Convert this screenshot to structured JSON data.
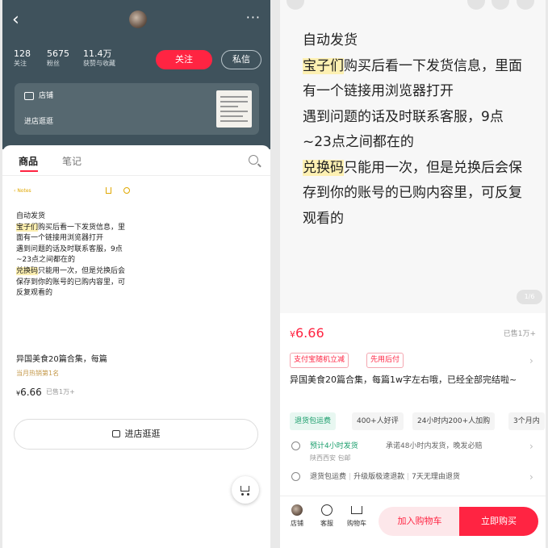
{
  "colors": {
    "brand": "#ff2442",
    "header_bg": "#3f525c",
    "highlight": "#fdf0b2",
    "green": "#1a9e6c"
  },
  "shop": {
    "stats": [
      {
        "num": "128",
        "label": "关注"
      },
      {
        "num": "5675",
        "label": "粉丝"
      },
      {
        "num": "11.4万",
        "label": "获赞与收藏"
      }
    ],
    "follow": "关注",
    "message": "私信",
    "store_label": "店铺",
    "store_link": "进店逛逛"
  },
  "tabs": {
    "goods": "商品",
    "notes": "笔记"
  },
  "note": {
    "app_back": "Notes",
    "lines": [
      {
        "hl": "",
        "text": "自动发货"
      },
      {
        "hl": "宝子们",
        "text": "购买后看一下发货信息，里面有一个链接用浏览器打开"
      },
      {
        "hl": "",
        "text": "遇到问题的话及时联系客服，9点~23点之间都在的"
      },
      {
        "hl": "兑换码",
        "text": "只能用一次，但是兑换后会保存到你的账号的已购内容里，可反复观看的"
      }
    ]
  },
  "product": {
    "title_short": "异国美食20篇合集，每篇",
    "rank": "当月热销第1名",
    "currency": "¥",
    "price": "6.66",
    "sold": "已售1万+"
  },
  "visit_store": "进店逛逛",
  "detail": {
    "page": "1/6",
    "tags": [
      "支付宝随机立减",
      "先用后付"
    ],
    "title": "异国美食20篇合集，每篇1w字左右哦，已经全部完结啦~",
    "features": [
      "退货包运费",
      "400+人好评",
      "24小时内200+人加购",
      "3个月内"
    ],
    "ship_fast": "预计4小时发货",
    "ship_promise": "承诺48小时内发货，晚发必赔",
    "ship_loc": "陕西西安 包邮",
    "guarantees": [
      "退货包运费",
      "升级版极速退款",
      "7天无理由退货"
    ]
  },
  "bottom": {
    "store": "店铺",
    "service": "客服",
    "cart": "购物车",
    "add_cart": "加入购物车",
    "buy_now": "立即购买"
  }
}
